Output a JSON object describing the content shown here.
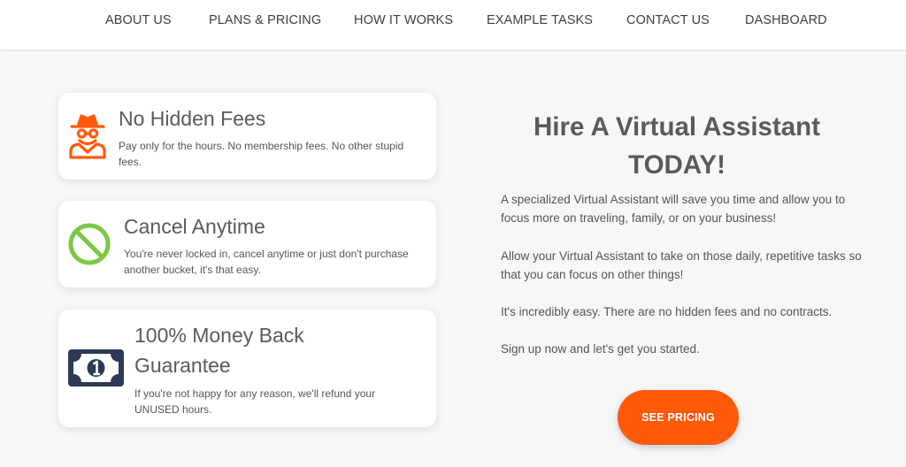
{
  "nav": {
    "items": [
      {
        "label": "ABOUT US"
      },
      {
        "label": "PLANS & PRICING"
      },
      {
        "label": "HOW IT WORKS"
      },
      {
        "label": "EXAMPLE TASKS"
      },
      {
        "label": "CONTACT US"
      },
      {
        "label": "DASHBOARD"
      }
    ]
  },
  "features": [
    {
      "title": "No Hidden Fees",
      "description": "Pay only for the hours. No membership fees. No other stupid fees.",
      "icon": "incognito-spy-icon",
      "icon_color": "#ff5a0a"
    },
    {
      "title": "Cancel Anytime",
      "description": "You're never locked in, cancel anytime or just don't purchase another bucket, it's that easy.",
      "icon": "prohibited-icon",
      "icon_color": "#7ac943"
    },
    {
      "title": "100% Money Back Guarantee",
      "description": "If you're not happy for any reason, we'll refund your UNUSED hours.",
      "icon": "money-bill-icon",
      "icon_color": "#2b3a55"
    }
  ],
  "hero": {
    "title": "Hire A Virtual Assistant TODAY!",
    "paragraphs": [
      "A specialized Virtual Assistant will save you time and allow you to focus more on traveling, family, or on your business!",
      "Allow your Virtual Assistant to take on those daily, repetitive tasks so that you can focus on other things!",
      "It's incredibly easy. There are no hidden fees and no contracts.",
      "Sign up now and let's get you started."
    ],
    "cta_label": "SEE PRICING"
  },
  "colors": {
    "accent": "#ff5a0a",
    "green": "#7ac943",
    "navy": "#2b3a55",
    "background": "#f7f7f7",
    "text": "#555555"
  }
}
